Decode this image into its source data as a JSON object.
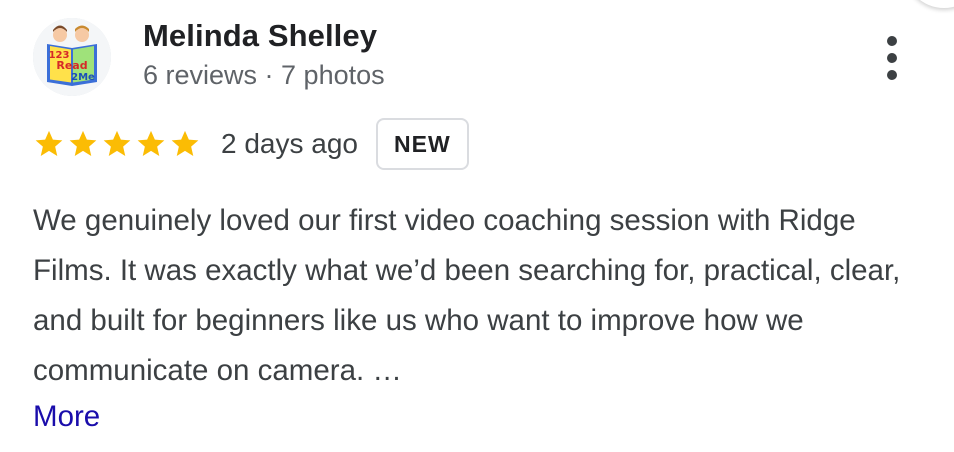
{
  "review": {
    "reviewer": {
      "name": "Melinda Shelley",
      "meta": "6 reviews · 7 photos",
      "avatar_text": [
        "123",
        "Read",
        "2Me"
      ]
    },
    "rating": 5,
    "max_rating": 5,
    "date": "2 days ago",
    "badge": "NEW",
    "text": "We genuinely loved our first video coaching session with Ridge Films. It was exactly what we’d been searching for, practical, clear, and built for beginners like us who want to improve how we communicate on camera. …",
    "more_label": "More",
    "menu_icon": "more-vert-icon"
  },
  "colors": {
    "star": "#fbbc04",
    "link": "#1a0dab",
    "name": "#202124",
    "meta": "#5f6368",
    "body": "#3c4043"
  }
}
